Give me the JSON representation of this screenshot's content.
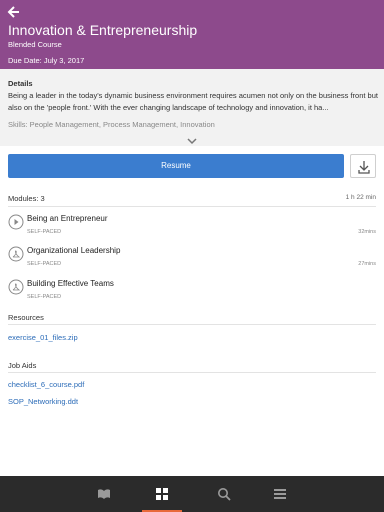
{
  "header": {
    "title": "Innovation & Entrepreneurship",
    "type": "Blended Course",
    "due_date": "Due Date: July 3, 2017",
    "background": "#8d4a8c",
    "back_icon": "back-arrow-icon"
  },
  "details": {
    "heading": "Details",
    "text": "Being a leader in the today's dynamic business environment requires acumen not only on the business front but also on the 'people front.' With the ever changing landscape of technology and innovation, it ha...",
    "skills": "Skills: People Management, Process Management, Innovation",
    "expand_icon": "chevron-down-icon"
  },
  "actions": {
    "resume_label": "Resume",
    "resume_color": "#3b7dcf",
    "download_icon": "download-icon"
  },
  "modules": {
    "label": "Modules: 3",
    "total_duration": "1 h 22 min",
    "items": [
      {
        "title": "Being an Entrepreneur",
        "type": "SELF-PACED",
        "duration": "32mins",
        "icon": "play-icon"
      },
      {
        "title": "Organizational Leadership",
        "type": "SELF-PACED",
        "duration": "27mins",
        "icon": "pdf-icon"
      },
      {
        "title": "Building Effective Teams",
        "type": "SELF-PACED",
        "duration": "",
        "icon": "pdf-icon"
      }
    ]
  },
  "resources": {
    "heading": "Resources",
    "items": [
      "exercise_01_files.zip"
    ]
  },
  "job_aids": {
    "heading": "Job Aids",
    "items": [
      "checklist_6_course.pdf",
      "SOP_Networking.ddt"
    ]
  },
  "bottom_nav": {
    "items": [
      {
        "icon": "book-icon",
        "active": false
      },
      {
        "icon": "grid-icon",
        "active": true
      },
      {
        "icon": "search-icon",
        "active": false
      },
      {
        "icon": "menu-icon",
        "active": false
      }
    ],
    "active_color": "#e8693a"
  }
}
